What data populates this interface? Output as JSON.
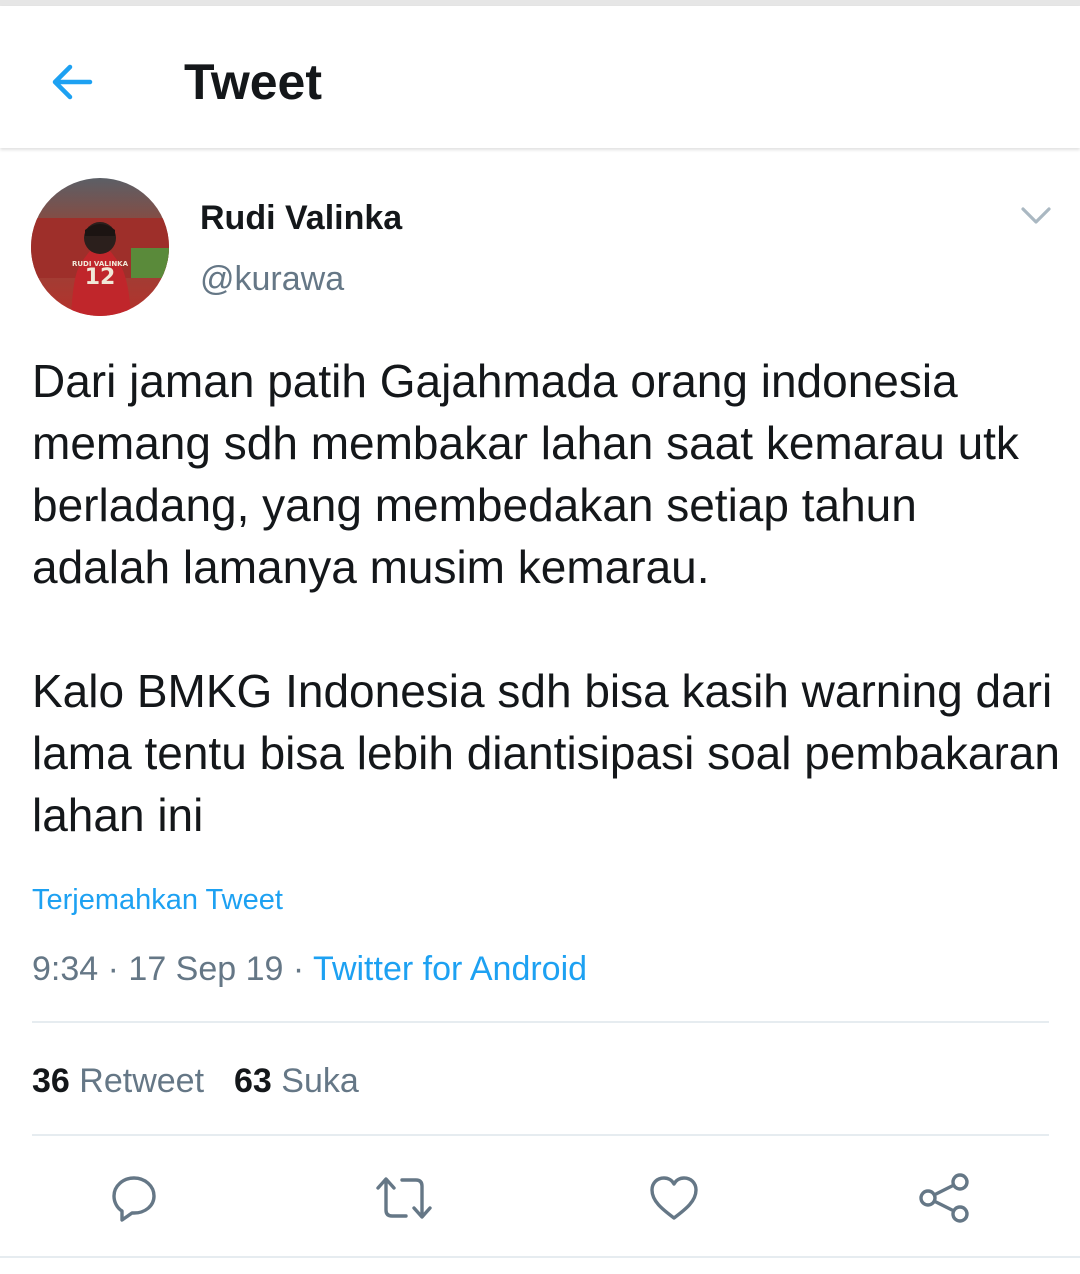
{
  "header": {
    "back_icon": "arrow-left-icon",
    "title": "Tweet"
  },
  "tweet": {
    "author": {
      "name": "Rudi Valinka",
      "handle": "@kurawa",
      "avatar_jersey_name": "RUDI VALINKA",
      "avatar_jersey_number": "12"
    },
    "menu_icon": "chevron-down-icon",
    "text_lines": [
      "Dari jaman patih Gajahmada orang indonesia memang sdh membakar lahan saat kemarau utk berladang, yang membedakan setiap tahun adalah lamanya musim kemarau.",
      "Kalo BMKG Indonesia sdh bisa kasih warning dari lama tentu bisa lebih diantisipasi soal pembakaran lahan ini"
    ],
    "translate_label": "Terjemahkan Tweet",
    "time": "9:34",
    "date": "17 Sep 19",
    "separator": " · ",
    "source": "Twitter for Android"
  },
  "stats": {
    "retweets_count": "36",
    "retweets_label": "Retweet",
    "likes_count": "63",
    "likes_label": "Suka"
  },
  "actions": [
    {
      "icon": "reply-icon"
    },
    {
      "icon": "retweet-icon"
    },
    {
      "icon": "like-icon"
    },
    {
      "icon": "share-icon"
    }
  ],
  "colors": {
    "accent": "#1da1f2",
    "text_primary": "#14171a",
    "text_secondary": "#657786",
    "divider": "#e6ecf0"
  }
}
